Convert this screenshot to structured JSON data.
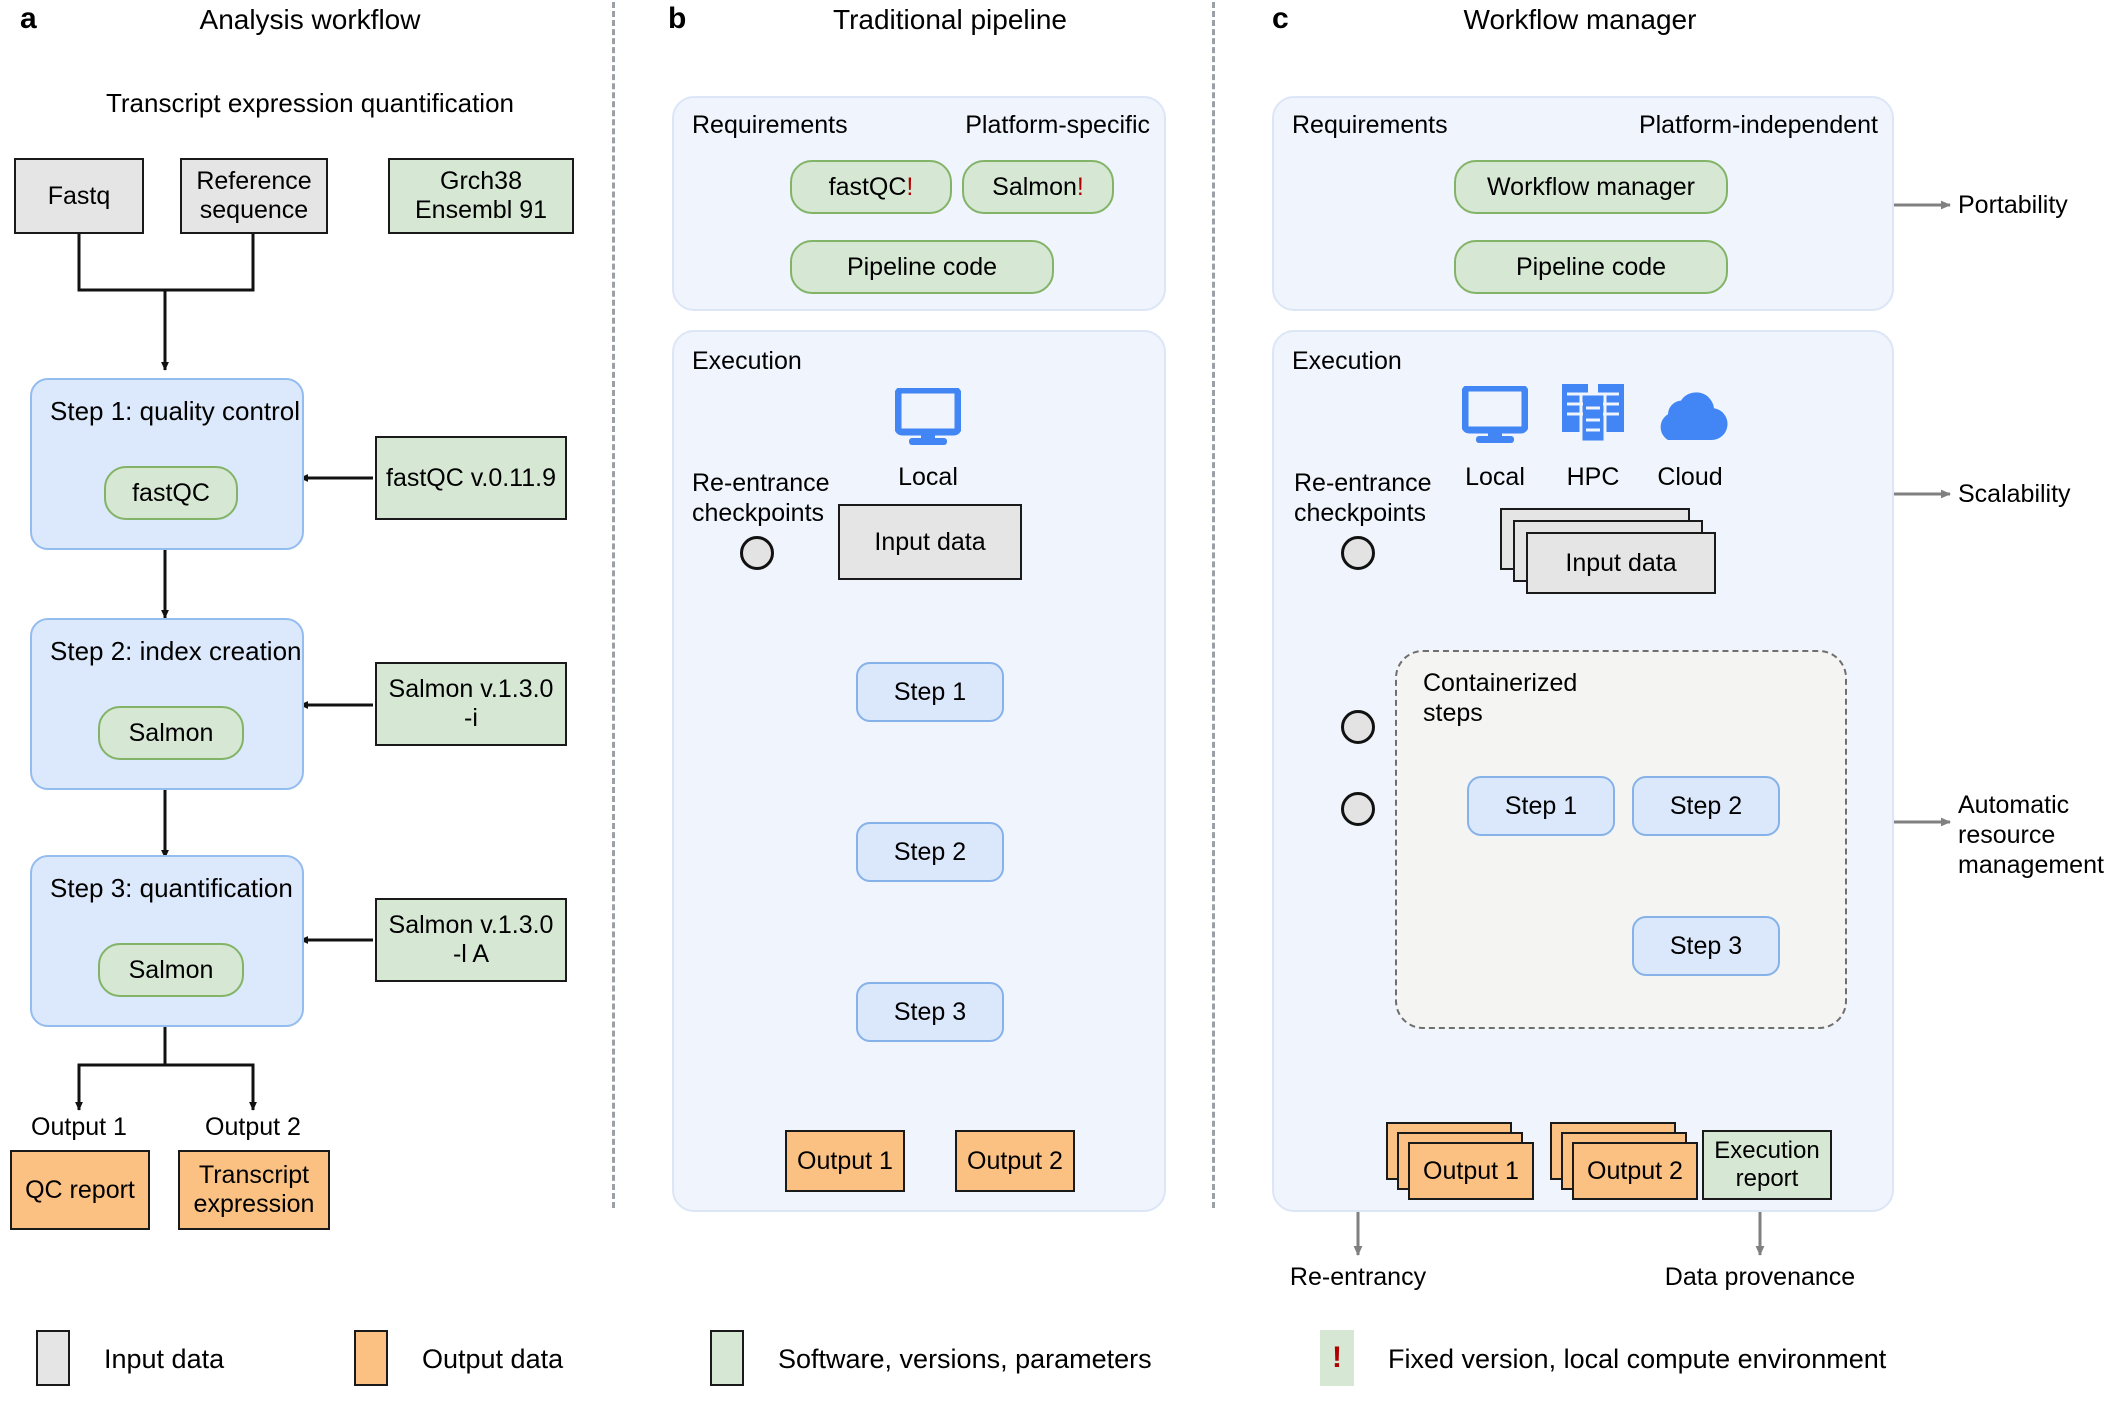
{
  "panels": {
    "a": {
      "letter": "a",
      "title": "Analysis workflow",
      "subtitle": "Transcript expression quantification",
      "inputs": [
        {
          "label": "Fastq"
        },
        {
          "label": "Reference\nsequence"
        }
      ],
      "reference_source": "Grch38\nEnsembl 91",
      "steps": [
        {
          "title": "Step 1: quality control",
          "tool": "fastQC",
          "param_box": "fastQC v.0.11.9"
        },
        {
          "title": "Step 2: index creation",
          "tool": "Salmon",
          "param_box": "Salmon v.1.3.0\n-i"
        },
        {
          "title": "Step 3: quantification",
          "tool": "Salmon",
          "param_box": "Salmon v.1.3.0\n-l A"
        }
      ],
      "outputs": [
        {
          "caption": "Output 1",
          "label": "QC report"
        },
        {
          "caption": "Output 2",
          "label": "Transcript\nexpression"
        }
      ]
    },
    "b": {
      "letter": "b",
      "title": "Traditional pipeline",
      "requirements": {
        "heading": "Requirements",
        "platform": "Platform-specific",
        "items": [
          {
            "label": "fastQC",
            "flag": "!"
          },
          {
            "label": "Salmon",
            "flag": "!"
          },
          {
            "label": "Pipeline code",
            "flag": ""
          }
        ]
      },
      "execution": {
        "heading": "Execution",
        "checkpoint_label": "Re-entrance\ncheckpoints",
        "compute": [
          {
            "icon": "monitor-icon",
            "label": "Local"
          }
        ],
        "input": "Input data",
        "steps": [
          "Step 1",
          "Step 2",
          "Step 3"
        ],
        "outputs": [
          "Output 1",
          "Output 2"
        ]
      }
    },
    "c": {
      "letter": "c",
      "title": "Workflow manager",
      "requirements": {
        "heading": "Requirements",
        "platform": "Platform-independent",
        "items": [
          {
            "label": "Workflow manager",
            "flag": ""
          },
          {
            "label": "Pipeline code",
            "flag": ""
          }
        ]
      },
      "execution": {
        "heading": "Execution",
        "checkpoint_label": "Re-entrance\ncheckpoints",
        "compute": [
          {
            "icon": "monitor-icon",
            "label": "Local"
          },
          {
            "icon": "server-rack-icon",
            "label": "HPC"
          },
          {
            "icon": "cloud-icon",
            "label": "Cloud"
          }
        ],
        "input": "Input data",
        "container_label": "Containerized\nsteps",
        "steps": [
          "Step 1",
          "Step 2",
          "Step 3"
        ],
        "outputs": [
          "Output 1",
          "Output 2"
        ],
        "report": "Execution\nreport"
      },
      "annotations": [
        "Portability",
        "Scalability",
        "Automatic resource\nmanagement"
      ],
      "bottom_labels": [
        "Re-entrancy",
        "Data provenance"
      ]
    }
  },
  "legend": [
    {
      "swatch": "input",
      "label": "Input data",
      "color": "#e5e5e5"
    },
    {
      "swatch": "output",
      "label": "Output data",
      "color": "#fbc183"
    },
    {
      "swatch": "software",
      "label": "Software, versions, parameters",
      "color": "#d6e8d4"
    },
    {
      "swatch": "fixed",
      "label": "Fixed version, local compute environment",
      "color": "#d6e8d4",
      "mark": "!"
    }
  ],
  "colors": {
    "input": "#e5e5e5",
    "output": "#fbc183",
    "software": "#d6e8d4",
    "step": "#dbe8fb",
    "card": "#eff4fd",
    "compute_icon": "#4285f4",
    "warning": "#b00000",
    "arrow_gray": "#808080"
  }
}
